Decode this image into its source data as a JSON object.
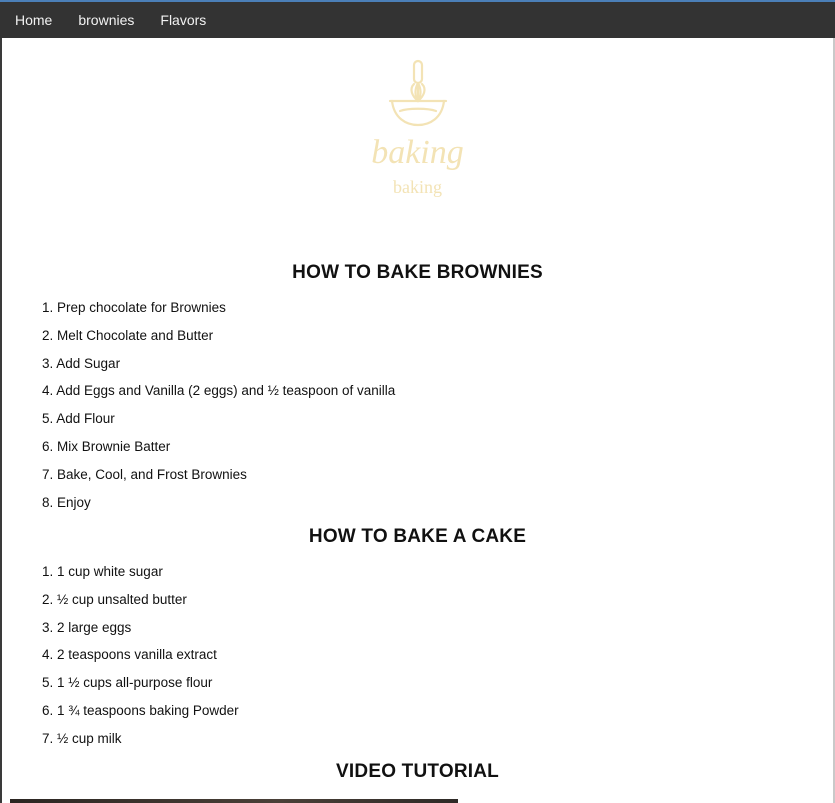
{
  "nav": {
    "items": [
      "Home",
      "brownies",
      "Flavors"
    ]
  },
  "logo": {
    "title": "baking",
    "subtitle": "baking",
    "icon": "whisk-bowl-icon",
    "color": "#f3e3b5"
  },
  "brownies": {
    "title": "HOW TO BAKE BROWNIES",
    "steps": [
      "1. Prep chocolate for Brownies",
      "2. Melt Chocolate and Butter",
      "3. Add Sugar",
      "4. Add Eggs and Vanilla (2 eggs) and ½ teaspoon of vanilla",
      "5. Add Flour",
      "6. Mix Brownie Batter",
      "7. Bake, Cool, and Frost Brownies",
      "8. Enjoy"
    ]
  },
  "cake": {
    "title": "HOW TO BAKE A CAKE",
    "steps": [
      "1. 1 cup white sugar",
      "2. ½ cup unsalted butter",
      "3. 2 large eggs",
      "4. 2 teaspoons vanilla extract",
      "5. 1 ½ cups all-purpose flour",
      "6. 1 ¾ teaspoons baking Powder",
      "7. ½ cup milk"
    ]
  },
  "video": {
    "title": "VIDEO TUTORIAL"
  }
}
